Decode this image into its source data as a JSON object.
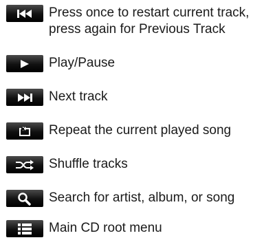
{
  "legend": [
    {
      "icon": "skip-back-icon",
      "lines": [
        "Press once to restart current track,",
        "press again for Previous Track"
      ]
    },
    {
      "icon": "play-icon",
      "lines": [
        "Play/Pause"
      ]
    },
    {
      "icon": "skip-forward-icon",
      "lines": [
        "Next track"
      ]
    },
    {
      "icon": "repeat-icon",
      "lines": [
        "Repeat the current played song"
      ]
    },
    {
      "icon": "shuffle-icon",
      "lines": [
        "Shuffle tracks"
      ]
    },
    {
      "icon": "search-icon",
      "lines": [
        "Search for artist, album, or song"
      ]
    },
    {
      "icon": "menu-list-icon",
      "lines": [
        "Main CD root menu"
      ]
    }
  ]
}
